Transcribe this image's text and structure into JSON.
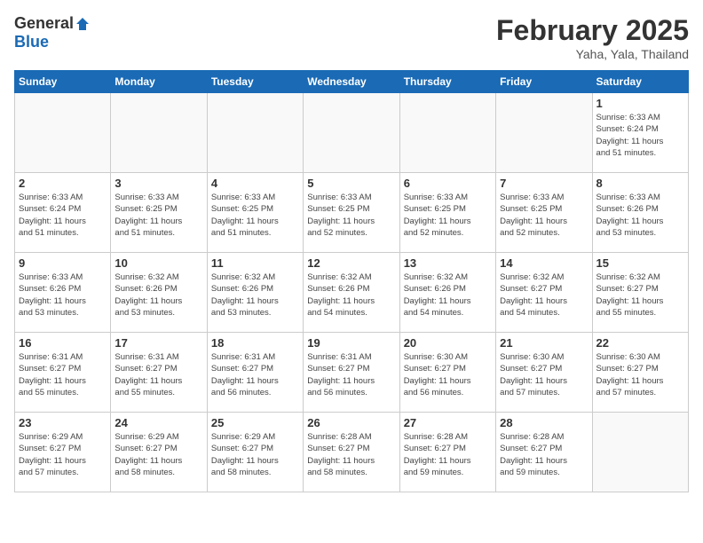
{
  "header": {
    "logo_general": "General",
    "logo_blue": "Blue",
    "month_title": "February 2025",
    "location": "Yaha, Yala, Thailand"
  },
  "calendar": {
    "days_of_week": [
      "Sunday",
      "Monday",
      "Tuesday",
      "Wednesday",
      "Thursday",
      "Friday",
      "Saturday"
    ],
    "weeks": [
      [
        {
          "day": "",
          "info": ""
        },
        {
          "day": "",
          "info": ""
        },
        {
          "day": "",
          "info": ""
        },
        {
          "day": "",
          "info": ""
        },
        {
          "day": "",
          "info": ""
        },
        {
          "day": "",
          "info": ""
        },
        {
          "day": "1",
          "info": "Sunrise: 6:33 AM\nSunset: 6:24 PM\nDaylight: 11 hours\nand 51 minutes."
        }
      ],
      [
        {
          "day": "2",
          "info": "Sunrise: 6:33 AM\nSunset: 6:24 PM\nDaylight: 11 hours\nand 51 minutes."
        },
        {
          "day": "3",
          "info": "Sunrise: 6:33 AM\nSunset: 6:25 PM\nDaylight: 11 hours\nand 51 minutes."
        },
        {
          "day": "4",
          "info": "Sunrise: 6:33 AM\nSunset: 6:25 PM\nDaylight: 11 hours\nand 51 minutes."
        },
        {
          "day": "5",
          "info": "Sunrise: 6:33 AM\nSunset: 6:25 PM\nDaylight: 11 hours\nand 52 minutes."
        },
        {
          "day": "6",
          "info": "Sunrise: 6:33 AM\nSunset: 6:25 PM\nDaylight: 11 hours\nand 52 minutes."
        },
        {
          "day": "7",
          "info": "Sunrise: 6:33 AM\nSunset: 6:25 PM\nDaylight: 11 hours\nand 52 minutes."
        },
        {
          "day": "8",
          "info": "Sunrise: 6:33 AM\nSunset: 6:26 PM\nDaylight: 11 hours\nand 53 minutes."
        }
      ],
      [
        {
          "day": "9",
          "info": "Sunrise: 6:33 AM\nSunset: 6:26 PM\nDaylight: 11 hours\nand 53 minutes."
        },
        {
          "day": "10",
          "info": "Sunrise: 6:32 AM\nSunset: 6:26 PM\nDaylight: 11 hours\nand 53 minutes."
        },
        {
          "day": "11",
          "info": "Sunrise: 6:32 AM\nSunset: 6:26 PM\nDaylight: 11 hours\nand 53 minutes."
        },
        {
          "day": "12",
          "info": "Sunrise: 6:32 AM\nSunset: 6:26 PM\nDaylight: 11 hours\nand 54 minutes."
        },
        {
          "day": "13",
          "info": "Sunrise: 6:32 AM\nSunset: 6:26 PM\nDaylight: 11 hours\nand 54 minutes."
        },
        {
          "day": "14",
          "info": "Sunrise: 6:32 AM\nSunset: 6:27 PM\nDaylight: 11 hours\nand 54 minutes."
        },
        {
          "day": "15",
          "info": "Sunrise: 6:32 AM\nSunset: 6:27 PM\nDaylight: 11 hours\nand 55 minutes."
        }
      ],
      [
        {
          "day": "16",
          "info": "Sunrise: 6:31 AM\nSunset: 6:27 PM\nDaylight: 11 hours\nand 55 minutes."
        },
        {
          "day": "17",
          "info": "Sunrise: 6:31 AM\nSunset: 6:27 PM\nDaylight: 11 hours\nand 55 minutes."
        },
        {
          "day": "18",
          "info": "Sunrise: 6:31 AM\nSunset: 6:27 PM\nDaylight: 11 hours\nand 56 minutes."
        },
        {
          "day": "19",
          "info": "Sunrise: 6:31 AM\nSunset: 6:27 PM\nDaylight: 11 hours\nand 56 minutes."
        },
        {
          "day": "20",
          "info": "Sunrise: 6:30 AM\nSunset: 6:27 PM\nDaylight: 11 hours\nand 56 minutes."
        },
        {
          "day": "21",
          "info": "Sunrise: 6:30 AM\nSunset: 6:27 PM\nDaylight: 11 hours\nand 57 minutes."
        },
        {
          "day": "22",
          "info": "Sunrise: 6:30 AM\nSunset: 6:27 PM\nDaylight: 11 hours\nand 57 minutes."
        }
      ],
      [
        {
          "day": "23",
          "info": "Sunrise: 6:29 AM\nSunset: 6:27 PM\nDaylight: 11 hours\nand 57 minutes."
        },
        {
          "day": "24",
          "info": "Sunrise: 6:29 AM\nSunset: 6:27 PM\nDaylight: 11 hours\nand 58 minutes."
        },
        {
          "day": "25",
          "info": "Sunrise: 6:29 AM\nSunset: 6:27 PM\nDaylight: 11 hours\nand 58 minutes."
        },
        {
          "day": "26",
          "info": "Sunrise: 6:28 AM\nSunset: 6:27 PM\nDaylight: 11 hours\nand 58 minutes."
        },
        {
          "day": "27",
          "info": "Sunrise: 6:28 AM\nSunset: 6:27 PM\nDaylight: 11 hours\nand 59 minutes."
        },
        {
          "day": "28",
          "info": "Sunrise: 6:28 AM\nSunset: 6:27 PM\nDaylight: 11 hours\nand 59 minutes."
        },
        {
          "day": "",
          "info": ""
        }
      ]
    ]
  }
}
